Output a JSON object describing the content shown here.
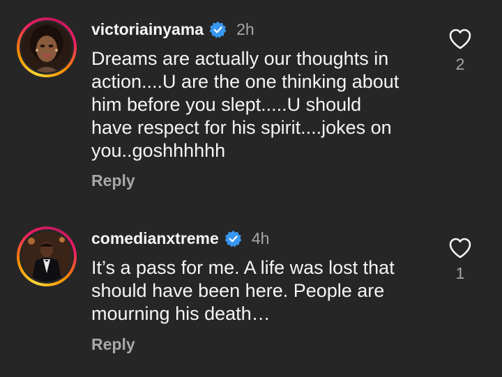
{
  "comments": [
    {
      "username": "victoriainyama",
      "verified": true,
      "time": "2h",
      "text": "Dreams are actually our thoughts in\naction....U are the one thinking about\nhim before you slept.....U should\nhave respect for his spirit....jokes on\nyou..goshhhhhh",
      "reply_label": "Reply",
      "like_count": "2",
      "icons": {
        "like": "heart-outline-icon",
        "verified": "verified-badge-icon"
      }
    },
    {
      "username": "comedianxtreme",
      "verified": true,
      "time": "4h",
      "text": "It’s a pass for me. A life was lost that\nshould have been here. People are\nmourning his death…",
      "reply_label": "Reply",
      "like_count": "1",
      "icons": {
        "like": "heart-outline-icon",
        "verified": "verified-badge-icon"
      }
    }
  ],
  "colors": {
    "background": "#262626",
    "text_primary": "#f5f5f5",
    "text_secondary": "#a8a8a8",
    "verified_badge": "#3897f0",
    "story_ring": [
      "#fdd835",
      "#fb8c00",
      "#e91e63"
    ]
  }
}
